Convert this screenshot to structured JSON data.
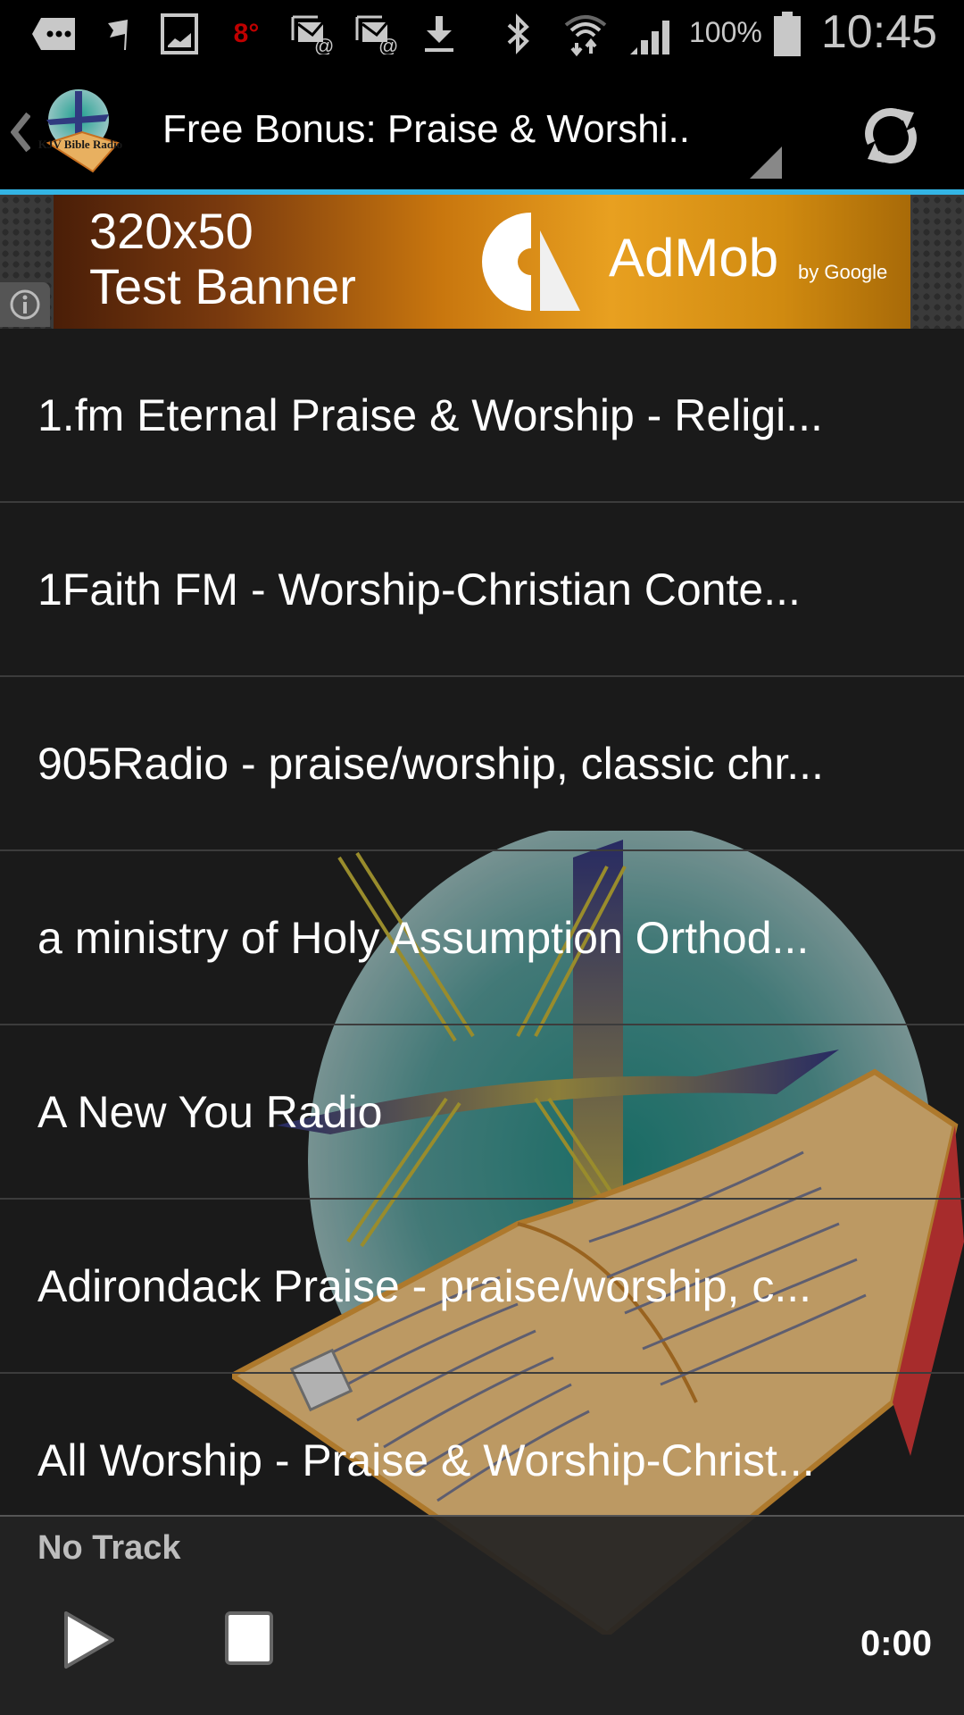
{
  "status_bar": {
    "icons": [
      "more-icon",
      "flag-icon",
      "image-icon",
      "temperature-icon",
      "email-error-icon",
      "email-error-icon",
      "download-icon",
      "bluetooth-icon",
      "wifi-icon",
      "signal-icon",
      "battery-icon"
    ],
    "temperature": "8°",
    "battery_percent": "100%",
    "time": "10:45"
  },
  "action_bar": {
    "app_logo_text": "KJV Bible Radio",
    "title": "Free Bonus: Praise & Worshi..",
    "refresh_icon": "refresh-icon",
    "accent_color": "#33b5e5"
  },
  "ad": {
    "line1": "320x50",
    "line2": "Test Banner",
    "brand": "AdMob",
    "brand_sub": "by Google"
  },
  "stations": [
    {
      "label": "1.fm Eternal Praise & Worship - Religi..."
    },
    {
      "label": "1Faith FM - Worship-Christian Conte..."
    },
    {
      "label": "905Radio - praise/worship, classic chr..."
    },
    {
      "label": "a ministry of Holy Assumption Orthod..."
    },
    {
      "label": "A New You Radio"
    },
    {
      "label": "Adirondack Praise - praise/worship, c..."
    },
    {
      "label": "All Worship - Praise & Worship-Christ..."
    }
  ],
  "player": {
    "track": "No Track",
    "time": "0:00",
    "play_icon": "play-icon",
    "stop_icon": "stop-icon"
  }
}
